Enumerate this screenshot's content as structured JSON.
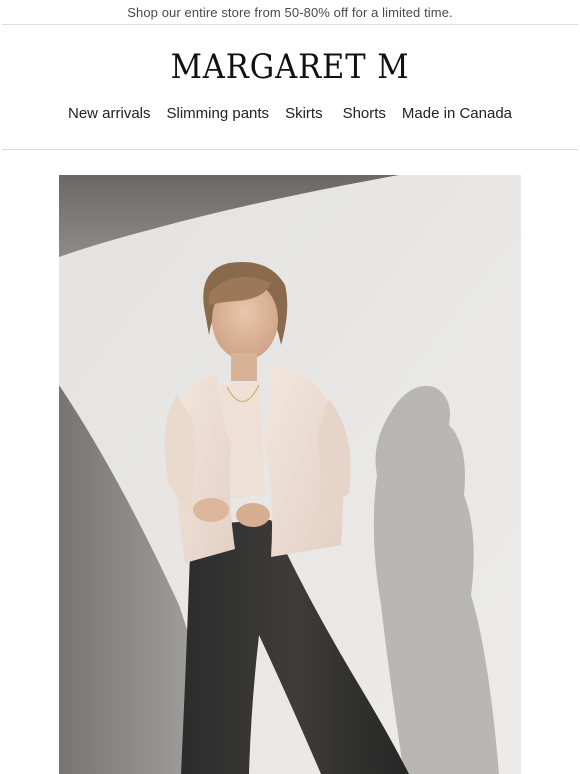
{
  "announcement": {
    "text": "Shop our entire store from 50-80% off for a limited time."
  },
  "header": {
    "logo_text": "MARGARET M"
  },
  "nav": {
    "items": [
      {
        "label": "New arrivals"
      },
      {
        "label": "Slimming pants"
      },
      {
        "label": "Skirts"
      },
      {
        "label": "Shorts"
      },
      {
        "label": "Made in Canada"
      }
    ]
  },
  "colors": {
    "background": "#ffffff",
    "divider": "#dcdcdc",
    "text": "#222222"
  }
}
